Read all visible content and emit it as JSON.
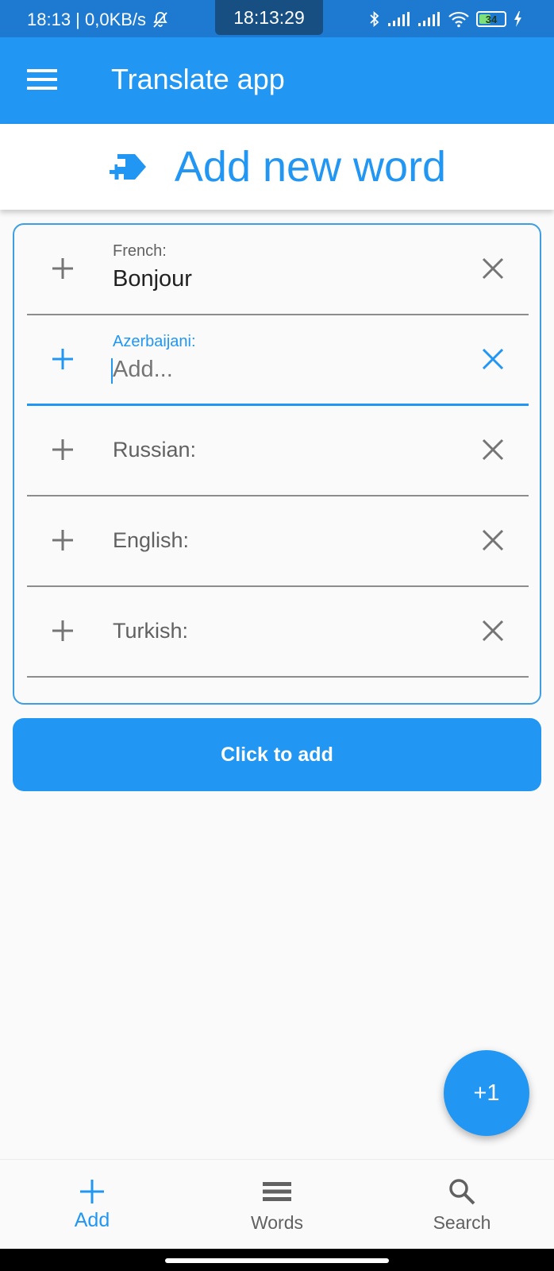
{
  "status_bar": {
    "time_speed": "18:13 | 0,0KB/s",
    "clock": "18:13:29",
    "battery": "34"
  },
  "app_bar": {
    "title": "Translate app"
  },
  "header": {
    "title": "Add new word"
  },
  "form": {
    "rows": [
      {
        "label": "French:",
        "value": "Bonjour",
        "state": "filled"
      },
      {
        "label": "Azerbaijani:",
        "placeholder": "Add...",
        "state": "focused"
      },
      {
        "label": "Russian:",
        "state": "empty"
      },
      {
        "label": "English:",
        "state": "empty"
      },
      {
        "label": "Turkish:",
        "state": "empty"
      }
    ]
  },
  "submit_label": "Click to add",
  "fab_label": "+1",
  "bottom_nav": {
    "items": [
      {
        "label": "Add",
        "icon": "plus-icon",
        "active": true
      },
      {
        "label": "Words",
        "icon": "list-icon",
        "active": false
      },
      {
        "label": "Search",
        "icon": "search-icon",
        "active": false
      }
    ]
  },
  "colors": {
    "primary": "#2196f3",
    "status_bar": "#1e7ad0"
  }
}
